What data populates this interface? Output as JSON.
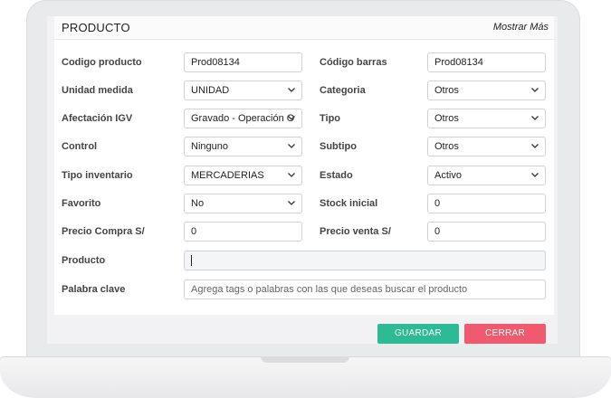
{
  "modal": {
    "title": "PRODUCTO",
    "show_more": "Mostrar Más"
  },
  "fields": {
    "codigo_producto": {
      "label": "Codigo producto",
      "value": "Prod08134"
    },
    "codigo_barras": {
      "label": "Código barras",
      "value": "Prod08134"
    },
    "unidad_medida": {
      "label": "Unidad medida",
      "value": "UNIDAD"
    },
    "categoria": {
      "label": "Categoria",
      "value": "Otros"
    },
    "afectacion_igv": {
      "label": "Afectación IGV",
      "value": "Gravado - Operación O"
    },
    "tipo": {
      "label": "Tipo",
      "value": "Otros"
    },
    "control": {
      "label": "Control",
      "value": "Ninguno"
    },
    "subtipo": {
      "label": "Subtipo",
      "value": "Otros"
    },
    "tipo_inventario": {
      "label": "Tipo inventario",
      "value": "MERCADERIAS"
    },
    "estado": {
      "label": "Estado",
      "value": "Activo"
    },
    "favorito": {
      "label": "Favorito",
      "value": "No"
    },
    "stock_inicial": {
      "label": "Stock inicial",
      "value": "0"
    },
    "precio_compra": {
      "label": "Precio Compra S/",
      "value": "0"
    },
    "precio_venta": {
      "label": "Precio venta S/",
      "value": "0"
    },
    "producto": {
      "label": "Producto",
      "value": ""
    },
    "palabra_clave": {
      "label": "Palabra clave",
      "placeholder": "Agrega tags o palabras con las que deseas buscar el producto"
    }
  },
  "actions": {
    "save_label": "GUARDAR",
    "close_label": "CERRAR"
  },
  "colors": {
    "save": "#2dbb96",
    "close": "#f05a6e"
  }
}
